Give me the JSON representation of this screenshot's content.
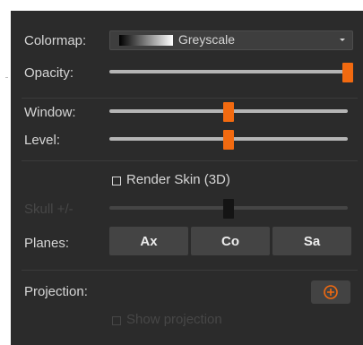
{
  "colormap": {
    "label": "Colormap:",
    "value": "Greyscale",
    "icon": "chevron-down-icon"
  },
  "opacity": {
    "label": "Opacity:",
    "value": 1.0
  },
  "window": {
    "label": "Window:",
    "value": 0.5
  },
  "level": {
    "label": "Level:",
    "value": 0.5
  },
  "render_skin": {
    "label": "Render Skin (3D)",
    "checked": false
  },
  "skull": {
    "label": "Skull +/-",
    "value": 0.5,
    "disabled": true
  },
  "planes": {
    "label": "Planes:",
    "buttons": [
      "Ax",
      "Co",
      "Sa"
    ]
  },
  "projection": {
    "label": "Projection:",
    "button_icon": "plus-circle-icon",
    "show_label": "Show projection",
    "show_checked": false,
    "show_disabled": true
  },
  "colors": {
    "panel_bg": "#2b2b2b",
    "accent": "#f26a10",
    "track": "#b5b5b5",
    "button_bg": "#444444"
  }
}
